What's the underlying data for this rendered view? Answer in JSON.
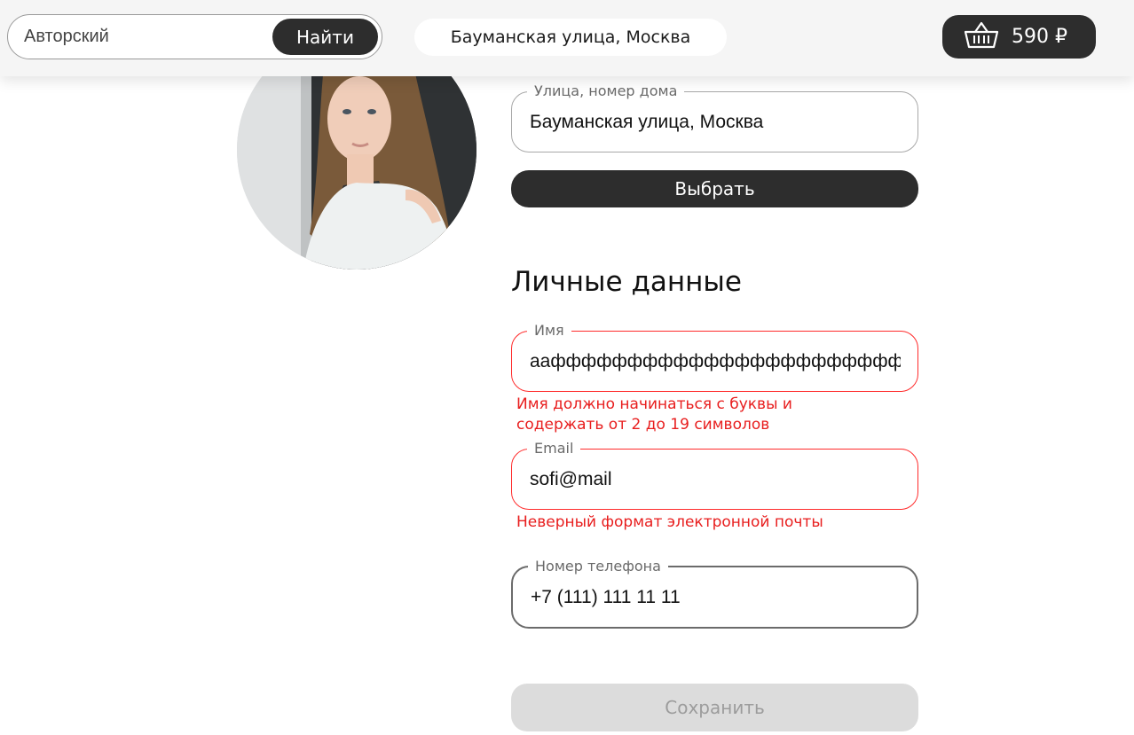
{
  "header": {
    "search": {
      "value": "Авторский",
      "button_label": "Найти"
    },
    "address": "Бауманская улица, Москва",
    "cart": {
      "total": "590 ₽"
    }
  },
  "address_form": {
    "street": {
      "label": "Улица, номер дома",
      "value": "Бауманская улица, Москва"
    },
    "select_button": "Выбрать"
  },
  "personal": {
    "title": "Личные данные",
    "name": {
      "label": "Имя",
      "value": "ааффффффффффффффффффффффффффф",
      "error": "Имя должно начинаться с буквы и содержать от 2 до 19 символов"
    },
    "email": {
      "label": "Email",
      "value": "sofi@mail",
      "error": "Неверный формат электронной почты"
    },
    "phone": {
      "label": "Номер телефона",
      "value": "+7 (111) 111 11 11"
    }
  },
  "save_button": "Сохранить",
  "colors": {
    "dark": "#2d2d2d",
    "error": "#e81e1e",
    "disabled": "#dcdcdc"
  }
}
